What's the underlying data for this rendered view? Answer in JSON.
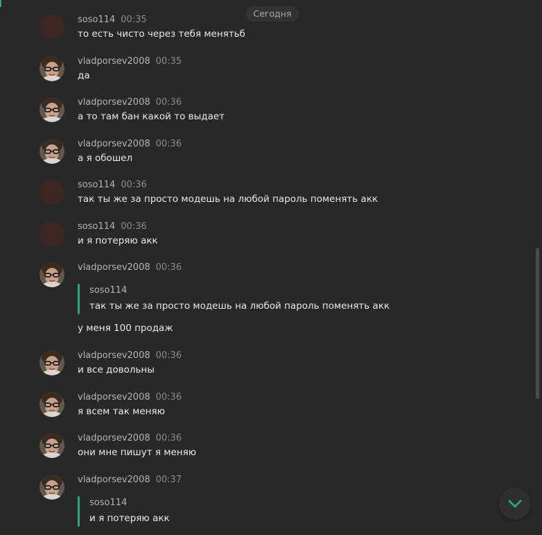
{
  "date_separator": "Сегодня",
  "colors": {
    "background": "#282828",
    "accent": "#2aa876",
    "scroll_button_icon": "#2aa876"
  },
  "icons": {
    "scroll_down": "chevron-down-icon"
  },
  "messages": [
    {
      "author": "soso114",
      "time": "00:35",
      "text": "то есть чисто через тебя менятьб"
    },
    {
      "author": "vladporsev2008",
      "time": "00:35",
      "text": "да"
    },
    {
      "author": "vladporsev2008",
      "time": "00:36",
      "text": "а то там бан какой то выдает"
    },
    {
      "author": "vladporsev2008",
      "time": "00:36",
      "text": "а я обошел"
    },
    {
      "author": "soso114",
      "time": "00:36",
      "text": "так ты же за просто модешь на любой пароль поменять акк"
    },
    {
      "author": "soso114",
      "time": "00:36",
      "text": "и я потеряю акк"
    },
    {
      "author": "vladporsev2008",
      "time": "00:36",
      "reply": {
        "author": "soso114",
        "text": "так ты же за просто модешь на любой пароль поменять акк"
      },
      "text": "у меня 100 продаж"
    },
    {
      "author": "vladporsev2008",
      "time": "00:36",
      "text": "и все довольны"
    },
    {
      "author": "vladporsev2008",
      "time": "00:36",
      "text": "я всем так меняю"
    },
    {
      "author": "vladporsev2008",
      "time": "00:36",
      "text": "они мне пишут я меняю"
    },
    {
      "author": "vladporsev2008",
      "time": "00:37",
      "reply": {
        "author": "soso114",
        "text": "и я потеряю акк"
      }
    }
  ]
}
